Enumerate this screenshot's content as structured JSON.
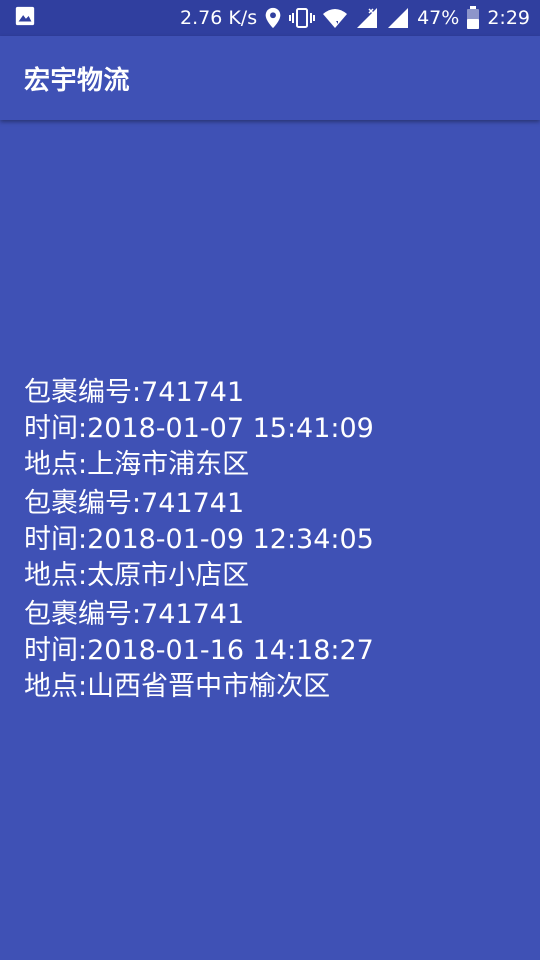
{
  "status_bar": {
    "network_speed": "2.76 K/s",
    "battery_percent": "47%",
    "time": "2:29",
    "icons": [
      "image-icon",
      "location-icon",
      "vibrate-icon",
      "wifi-icon",
      "signal-icon",
      "signal-icon",
      "battery-icon"
    ]
  },
  "app_bar": {
    "title": "宏宇物流"
  },
  "records": [
    {
      "package": "包裹编号:741741",
      "time": "时间:2018-01-07 15:41:09",
      "location": "地点:上海市浦东区"
    },
    {
      "package": "包裹编号:741741",
      "time": "时间:2018-01-09 12:34:05",
      "location": "地点:太原市小店区"
    },
    {
      "package": "包裹编号:741741",
      "time": "时间:2018-01-16 14:18:27",
      "location": "地点:山西省晋中市榆次区"
    }
  ],
  "colors": {
    "primary": "#3f51b5",
    "primary_dark": "#303f9f",
    "text": "#ffffff"
  }
}
